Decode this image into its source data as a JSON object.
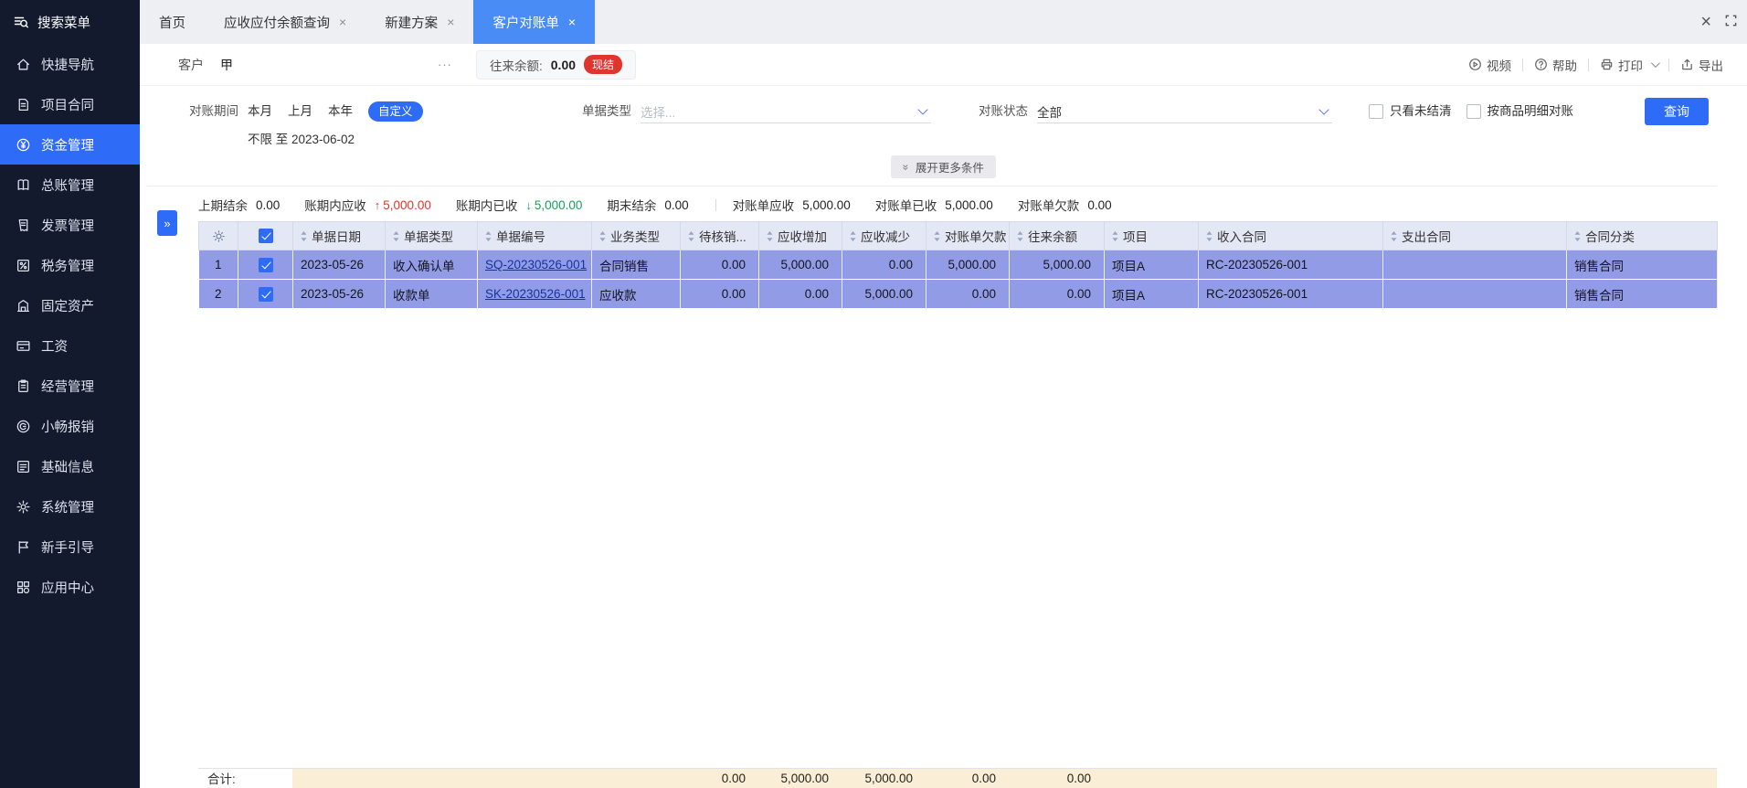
{
  "colors": {
    "sidebar_bg": "#131a2e",
    "accent_blue": "#2e6bf6",
    "tab_bar_bg": "#edeff3",
    "tab_active_bg": "#4a8cf5",
    "row_selected_bg": "#929ce6",
    "table_header_bg": "#e3e8f4",
    "total_row_bg": "#fbeed7",
    "badge_red": "#e0352c",
    "value_red": "#e0352c",
    "value_green": "#16a05d",
    "link_blue": "#16339c"
  },
  "icons": {
    "close_glyph": "×",
    "more_glyph": "···",
    "expand_glyph": "»",
    "up_arrow": "↑",
    "down_arrow": "↓"
  },
  "sidebar": {
    "search_label": "搜索菜单",
    "items": [
      {
        "label": "快捷导航",
        "active": false
      },
      {
        "label": "项目合同",
        "active": false
      },
      {
        "label": "资金管理",
        "active": true
      },
      {
        "label": "总账管理",
        "active": false
      },
      {
        "label": "发票管理",
        "active": false
      },
      {
        "label": "税务管理",
        "active": false
      },
      {
        "label": "固定资产",
        "active": false
      },
      {
        "label": "工资",
        "active": false
      },
      {
        "label": "经营管理",
        "active": false
      },
      {
        "label": "小畅报销",
        "active": false
      },
      {
        "label": "基础信息",
        "active": false
      },
      {
        "label": "系统管理",
        "active": false
      },
      {
        "label": "新手引导",
        "active": false
      },
      {
        "label": "应用中心",
        "active": false
      }
    ]
  },
  "tabs": {
    "items": [
      {
        "label": "首页",
        "closable": false,
        "active": false
      },
      {
        "label": "应收应付余额查询",
        "closable": true,
        "active": false
      },
      {
        "label": "新建方案",
        "closable": true,
        "active": false
      },
      {
        "label": "客户对账单",
        "closable": true,
        "active": true
      }
    ]
  },
  "toolbar": {
    "customer_label": "客户",
    "customer_value": "甲",
    "balance_label": "往来余额:",
    "balance_value": "0.00",
    "balance_badge": "现结",
    "video_label": "视频",
    "help_label": "帮助",
    "print_label": "打印",
    "export_label": "导出"
  },
  "filters": {
    "period_label": "对账期间",
    "period_options": [
      "本月",
      "上月",
      "本年",
      "自定义"
    ],
    "period_selected": "自定义",
    "period_range": "不限 至 2023-06-02",
    "doc_type_label": "单据类型",
    "doc_type_placeholder": "选择...",
    "status_label": "对账状态",
    "status_value": "全部",
    "checkbox_unsettled": {
      "label": "只看未结清",
      "checked": false
    },
    "checkbox_by_product": {
      "label": "按商品明细对账",
      "checked": false
    },
    "query_button": "查询",
    "expand_more": "展开更多条件"
  },
  "summary": {
    "prev_balance_label": "上期结余",
    "prev_balance_value": "0.00",
    "period_receivable_label": "账期内应收",
    "period_receivable_value": "5,000.00",
    "period_received_label": "账期内已收",
    "period_received_value": "5,000.00",
    "end_balance_label": "期末结余",
    "end_balance_value": "0.00",
    "stmt_receivable_label": "对账单应收",
    "stmt_receivable_value": "5,000.00",
    "stmt_received_label": "对账单已收",
    "stmt_received_value": "5,000.00",
    "stmt_arrears_label": "对账单欠款",
    "stmt_arrears_value": "0.00"
  },
  "table": {
    "select_all_checked": true,
    "columns": [
      "单据日期",
      "单据类型",
      "单据编号",
      "业务类型",
      "待核销...",
      "应收增加",
      "应收减少",
      "对账单欠款",
      "往来余额",
      "项目",
      "收入合同",
      "支出合同",
      "合同分类"
    ],
    "rows": [
      {
        "seq": "1",
        "checked": true,
        "date": "2023-05-26",
        "doc_type": "收入确认单",
        "doc_no": "SQ-20230526-001",
        "biz_type": "合同销售",
        "pending": "0.00",
        "ar_increase": "5,000.00",
        "ar_decrease": "0.00",
        "arrears": "5,000.00",
        "balance": "5,000.00",
        "project": "项目A",
        "income_contract": "RC-20230526-001",
        "expense_contract": "",
        "contract_category": "销售合同"
      },
      {
        "seq": "2",
        "checked": true,
        "date": "2023-05-26",
        "doc_type": "收款单",
        "doc_no": "SK-20230526-001",
        "biz_type": "应收款",
        "pending": "0.00",
        "ar_increase": "0.00",
        "ar_decrease": "5,000.00",
        "arrears": "0.00",
        "balance": "0.00",
        "project": "项目A",
        "income_contract": "RC-20230526-001",
        "expense_contract": "",
        "contract_category": "销售合同"
      }
    ],
    "total": {
      "label": "合计:",
      "pending": "0.00",
      "ar_increase": "5,000.00",
      "ar_decrease": "5,000.00",
      "arrears": "0.00",
      "balance": "0.00"
    }
  }
}
